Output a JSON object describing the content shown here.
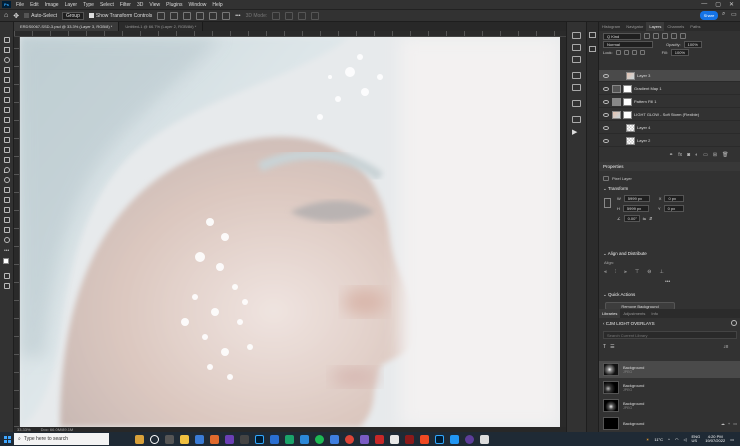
{
  "menubar": {
    "logo": "Ps",
    "items": [
      "File",
      "Edit",
      "Image",
      "Layer",
      "Type",
      "Select",
      "Filter",
      "3D",
      "View",
      "Plugins",
      "Window",
      "Help"
    ]
  },
  "optbar": {
    "auto_select": "Auto-Select",
    "group": "Group",
    "show_transform": "Show Transform Controls",
    "mode_3d": "3D Mode:",
    "share": "Share"
  },
  "tabs": [
    {
      "label": "ERDS0067-SSD-3.psd @ 33.3% (Layer 3, RGB/8) *",
      "active": true
    },
    {
      "label": "Untitled-1 @ 66.7% (Layer 2, RGB/8#) *",
      "active": false
    }
  ],
  "status": {
    "zoom": "33.33%",
    "doc": "Doc: 66.0M/89.1M"
  },
  "layers_panel": {
    "tabs": [
      "Histogram",
      "Navigator",
      "Layers",
      "Channels",
      "Paths"
    ],
    "kind": "Q Kind",
    "blend": "Normal",
    "opacity_label": "Opacity:",
    "opacity": "100%",
    "lock_label": "Lock:",
    "fill_label": "Fill:",
    "fill": "100%",
    "layers": [
      {
        "name": "Layer 3",
        "selected": true
      },
      {
        "name": "Gradient Map 1",
        "selected": false
      },
      {
        "name": "Pattern Fill 1",
        "selected": false
      },
      {
        "name": "LIGHT GLOW - Soft Storm (Flexible)",
        "selected": false
      },
      {
        "name": "Layer 4",
        "selected": false
      },
      {
        "name": "Layer 2",
        "selected": false
      }
    ]
  },
  "properties": {
    "title": "Properties",
    "pixel_layer": "Pixel Layer",
    "transform": "Transform",
    "w_label": "W",
    "w": "5999 px",
    "x_label": "X",
    "x": "0 px",
    "h_label": "H",
    "h": "5999 px",
    "y_label": "Y",
    "y": "0 px",
    "angle": "0.00°",
    "align_title": "Align and Distribute",
    "align_label": "Align:",
    "quick_title": "Quick Actions",
    "remove_bg": "Remove Background"
  },
  "libraries": {
    "tabs": [
      "Libraries",
      "Adjustments",
      "Info"
    ],
    "library_name": "CJM LIGHT OVERLAYS",
    "search_placeholder": "Search Current Library",
    "items": [
      {
        "name": "Background",
        "sub": "JPEG",
        "selected": true
      },
      {
        "name": "Background",
        "sub": "JPEG",
        "selected": false
      },
      {
        "name": "Background",
        "sub": "JPEG",
        "selected": false
      },
      {
        "name": "Background",
        "sub": "",
        "selected": false
      }
    ]
  },
  "taskbar": {
    "search_placeholder": "Type here to search",
    "temp": "11°C",
    "lang": "ENG",
    "region": "US",
    "time": "4:20 PM",
    "date": "19/07/2022"
  },
  "colors": {
    "accent": "#1473e6",
    "ps_blue": "#31a8ff",
    "panel": "#323232",
    "selected_row": "#4a4a4a"
  }
}
